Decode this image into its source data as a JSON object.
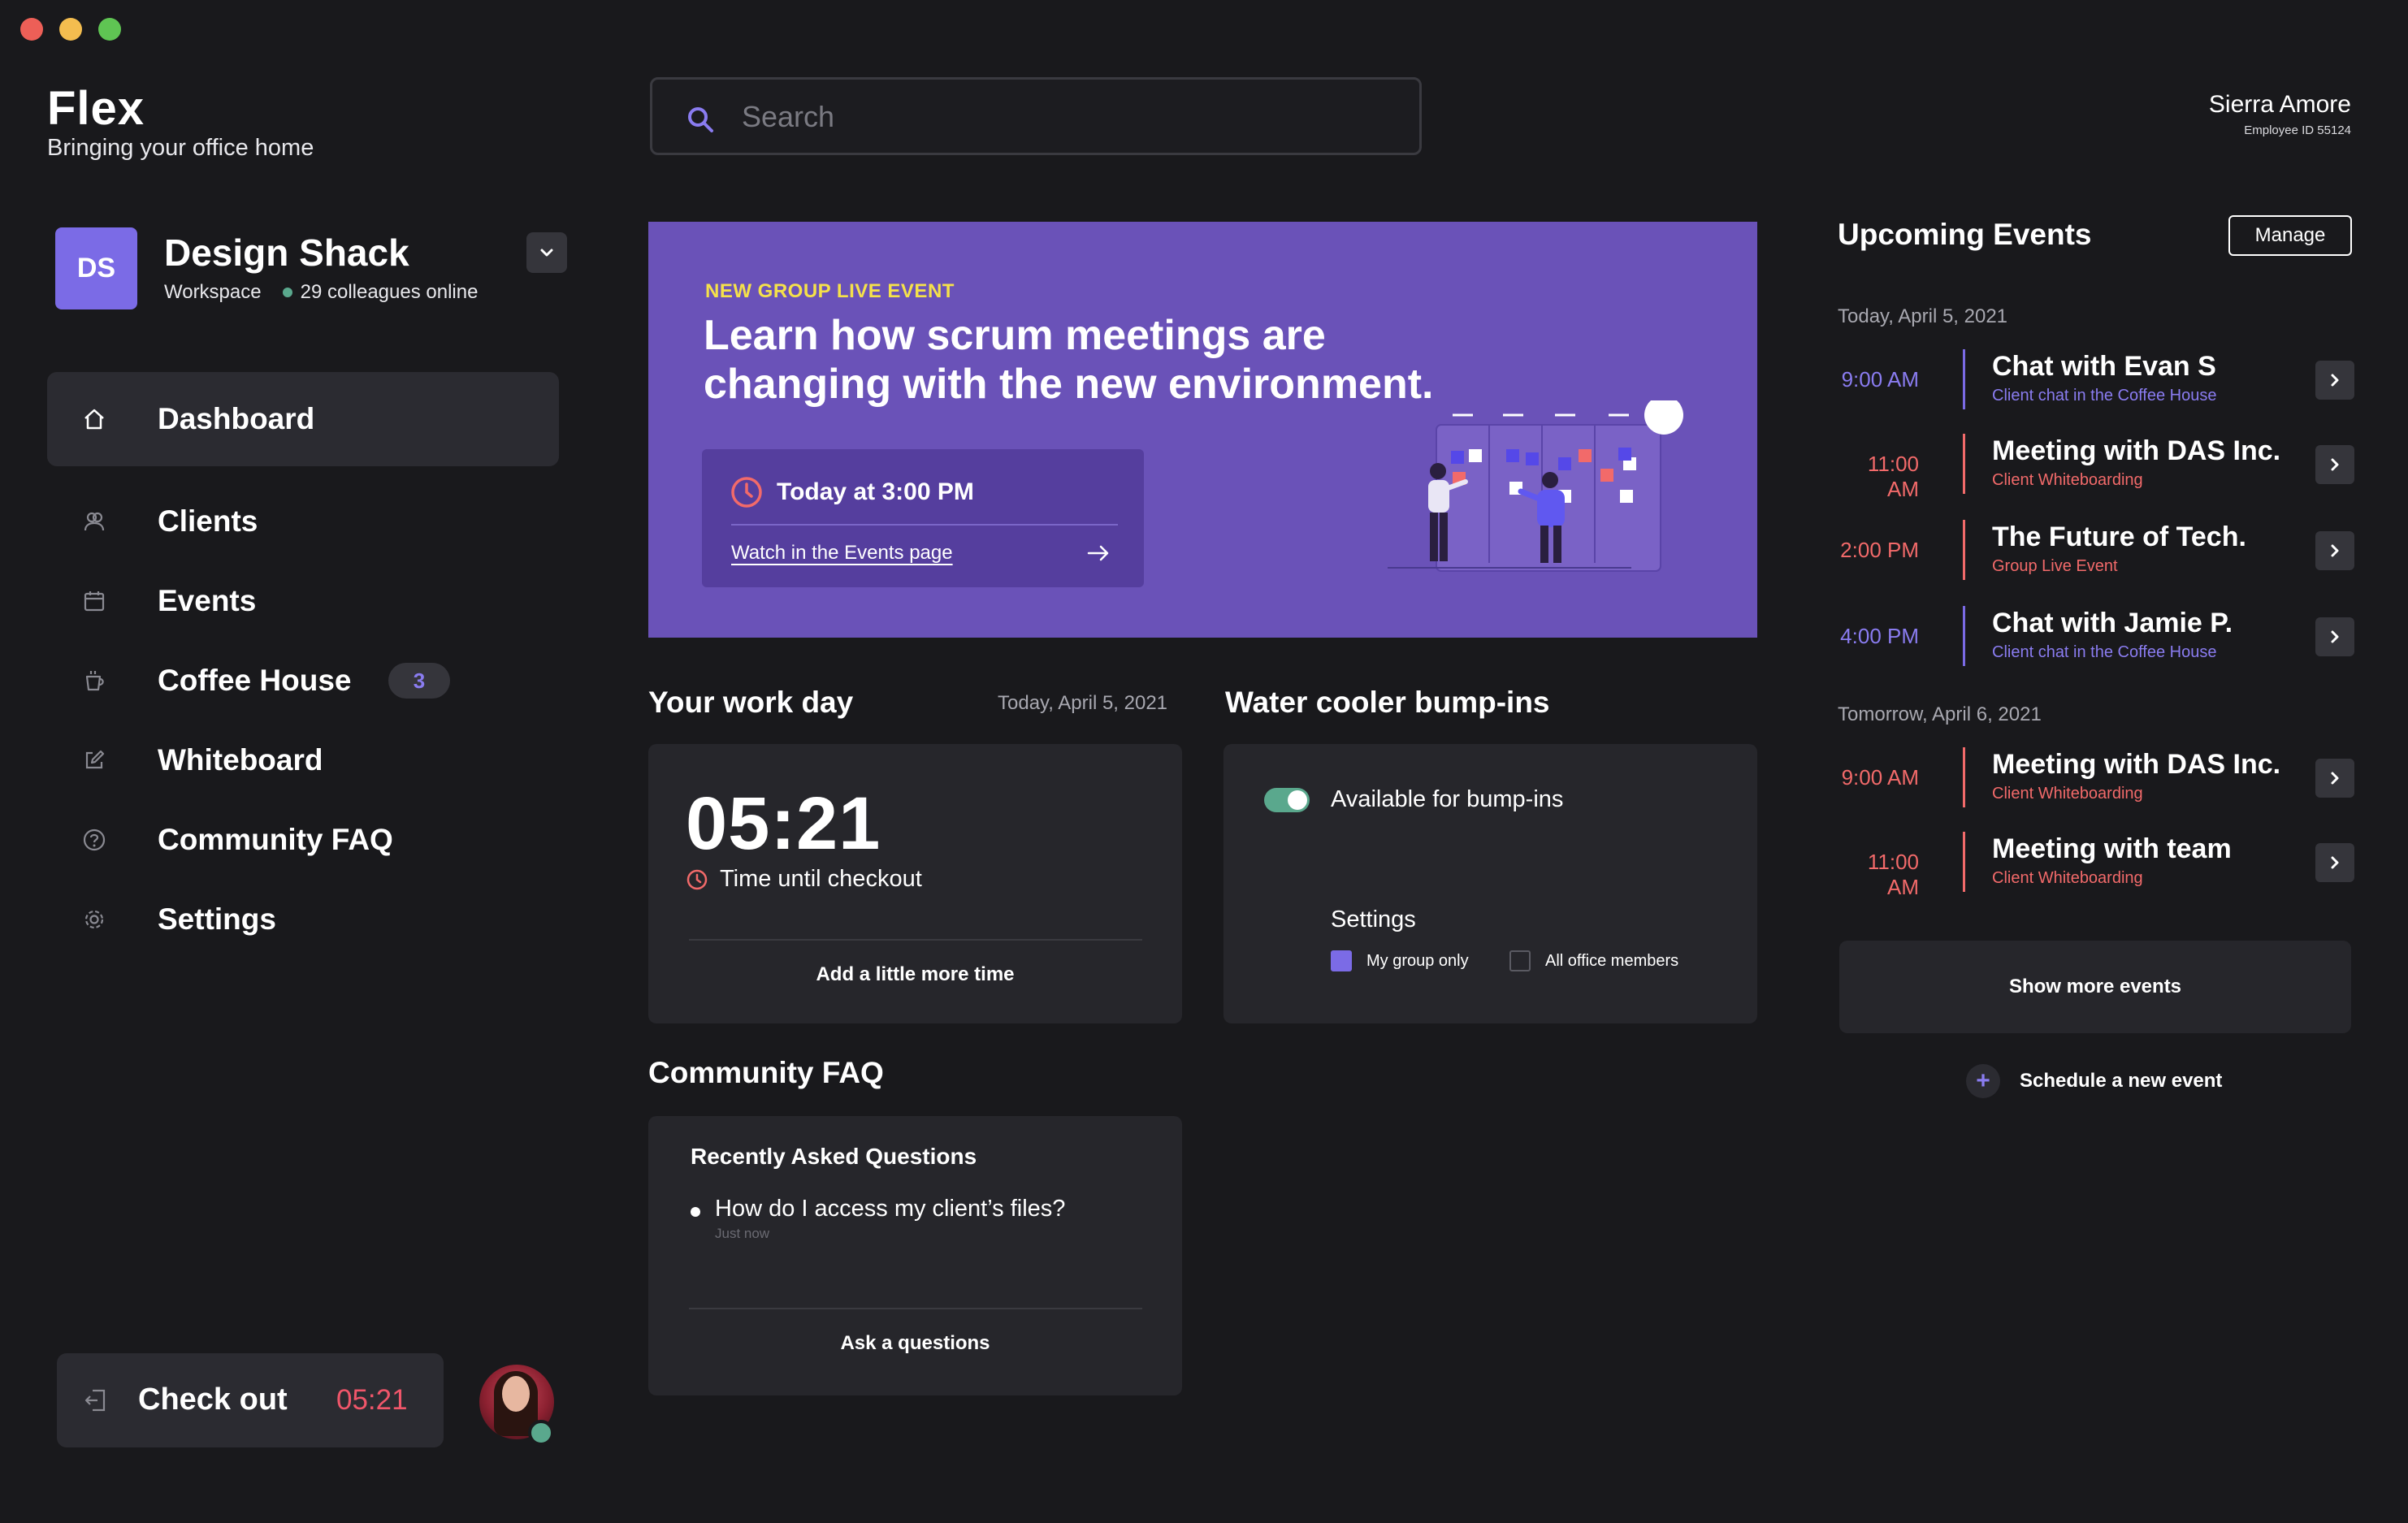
{
  "window": {
    "controls": [
      "close",
      "minimize",
      "zoom"
    ]
  },
  "brand": {
    "title": "Flex",
    "subtitle": "Bringing your office home"
  },
  "workspace": {
    "initials": "DS",
    "name": "Design Shack",
    "type": "Workspace",
    "online": "29 colleagues online",
    "toggle_icon": "chevron-down-icon"
  },
  "nav": {
    "active": "Dashboard",
    "items": [
      {
        "label": "Dashboard",
        "icon": "home-icon"
      },
      {
        "label": "Clients",
        "icon": "users-icon"
      },
      {
        "label": "Events",
        "icon": "calendar-icon"
      },
      {
        "label": "Coffee House",
        "icon": "coffee-icon",
        "badge": "3"
      },
      {
        "label": "Whiteboard",
        "icon": "edit-icon"
      },
      {
        "label": "Community FAQ",
        "icon": "help-icon"
      },
      {
        "label": "Settings",
        "icon": "gear-icon"
      }
    ]
  },
  "checkout": {
    "label": "Check out",
    "time": "05:21"
  },
  "search": {
    "placeholder": "Search",
    "value": ""
  },
  "user": {
    "name": "Sierra Amore",
    "employee_id": "Employee ID 55124",
    "status": "online"
  },
  "hero": {
    "tag": "NEW GROUP LIVE EVENT",
    "title": "Learn how scrum meetings are changing with the new environment.",
    "time": "Today at 3:00 PM",
    "link": "Watch in the Events page"
  },
  "workday": {
    "heading": "Your work day",
    "date": "Today, April 5, 2021",
    "time": "05:21",
    "subtitle": "Time until checkout",
    "button": "Add a little more time"
  },
  "cooler": {
    "heading": "Water cooler bump-ins",
    "available_label": "Available for bump-ins",
    "available": true,
    "settings_label": "Settings",
    "options": [
      {
        "label": "My group only",
        "checked": true
      },
      {
        "label": "All office members",
        "checked": false
      }
    ]
  },
  "faq": {
    "heading": "Community FAQ",
    "card_title": "Recently Asked Questions",
    "questions": [
      {
        "text": "How do I access my client’s files?",
        "time": "Just now"
      }
    ],
    "button": "Ask a questions"
  },
  "upcoming": {
    "heading": "Upcoming Events",
    "manage": "Manage",
    "days": [
      {
        "label": "Today, April 5, 2021",
        "events": [
          {
            "time": "9:00 AM",
            "title": "Chat with Evan S",
            "subtitle": "Client chat in the Coffee House",
            "color": "#8a7cf0"
          },
          {
            "time": "11:00 AM",
            "title": "Meeting with DAS Inc.",
            "subtitle": "Client Whiteboarding",
            "color": "#f26a6a"
          },
          {
            "time": "2:00 PM",
            "title": "The Future of Tech.",
            "subtitle": "Group Live Event",
            "color": "#f26a6a"
          },
          {
            "time": "4:00 PM",
            "title": "Chat with Jamie P.",
            "subtitle": "Client chat in the Coffee House",
            "color": "#8a7cf0"
          }
        ]
      },
      {
        "label": "Tomorrow, April 6, 2021",
        "events": [
          {
            "time": "9:00 AM",
            "title": "Meeting with DAS Inc.",
            "subtitle": "Client Whiteboarding",
            "color": "#f26a6a"
          },
          {
            "time": "11:00 AM",
            "title": "Meeting with team",
            "subtitle": "Client Whiteboarding",
            "color": "#f26a6a"
          }
        ]
      }
    ],
    "show_more": "Show more events",
    "schedule": "Schedule a new event"
  },
  "colors": {
    "background": "#19191c",
    "card": "#26262b",
    "accent": "#7b6be6",
    "hero": "#6a52b8",
    "alert": "#f26a6a",
    "online": "#5aa88d",
    "tag": "#f5e14a"
  }
}
